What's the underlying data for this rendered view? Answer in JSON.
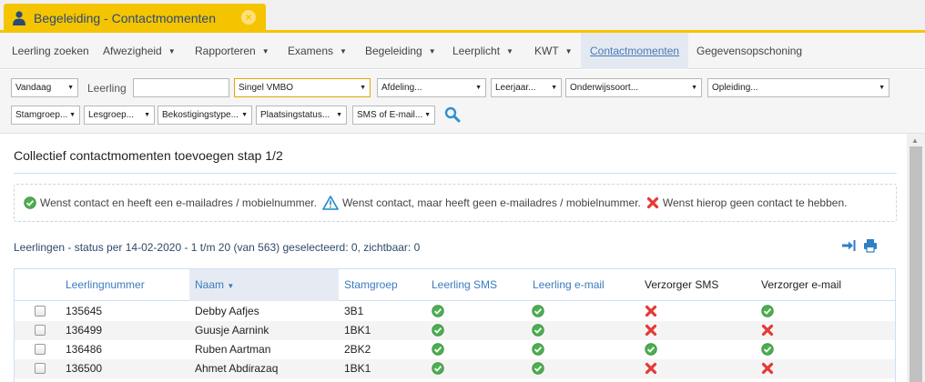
{
  "tab": {
    "title": "Begeleiding - Contactmomenten",
    "close": "×"
  },
  "menu": [
    {
      "label": "Leerling zoeken",
      "dropdown": false
    },
    {
      "label": "Afwezigheid",
      "dropdown": true
    },
    {
      "label": "Rapporteren",
      "dropdown": true
    },
    {
      "label": "Examens",
      "dropdown": true
    },
    {
      "label": "Begeleiding",
      "dropdown": true
    },
    {
      "label": "Leerplicht",
      "dropdown": true
    },
    {
      "label": "KWT",
      "dropdown": true
    },
    {
      "label": "Contactmomenten",
      "dropdown": false,
      "active": true
    },
    {
      "label": "Gegevensopschoning",
      "dropdown": false
    }
  ],
  "filters": {
    "vandaag": "Vandaag",
    "leerling_label": "Leerling",
    "leerling_value": "",
    "school": "Singel VMBO",
    "afdeling": "Afdeling...",
    "leerjaar": "Leerjaar...",
    "onderwijssoort": "Onderwijssoort...",
    "opleiding": "Opleiding...",
    "stamgroep": "Stamgroep...",
    "lesgroep": "Lesgroep...",
    "bekostigingstype": "Bekostigingstype...",
    "plaatsingstatus": "Plaatsingstatus...",
    "sms_email": "SMS of E-mail..."
  },
  "heading": "Collectief contactmomenten toevoegen stap 1/2",
  "legend": {
    "ok": "Wenst contact en heeft een e-mailadres / mobielnummer.",
    "warn": "Wenst contact, maar heeft geen e-mailadres / mobielnummer.",
    "no": "Wenst hierop geen contact te hebben."
  },
  "status_line": "Leerlingen - status per 14-02-2020 - 1 t/m 20 (van 563) geselecteerd: 0, zichtbaar: 0",
  "table": {
    "headers": {
      "nummer": "Leerlingnummer",
      "naam": "Naam",
      "stamgroep": "Stamgroep",
      "l_sms": "Leerling SMS",
      "l_email": "Leerling e-mail",
      "v_sms": "Verzorger SMS",
      "v_email": "Verzorger e-mail"
    },
    "rows": [
      {
        "nummer": "135645",
        "naam": "Debby Aafjes",
        "stamgroep": "3B1",
        "l_sms": "ok",
        "l_email": "ok",
        "v_sms": "no",
        "v_email": "ok"
      },
      {
        "nummer": "136499",
        "naam": "Guusje Aarnink",
        "stamgroep": "1BK1",
        "l_sms": "ok",
        "l_email": "ok",
        "v_sms": "no",
        "v_email": "no"
      },
      {
        "nummer": "136486",
        "naam": "Ruben Aartman",
        "stamgroep": "2BK2",
        "l_sms": "ok",
        "l_email": "ok",
        "v_sms": "ok",
        "v_email": "ok"
      },
      {
        "nummer": "136500",
        "naam": "Ahmet Abdirazaq",
        "stamgroep": "1BK1",
        "l_sms": "ok",
        "l_email": "ok",
        "v_sms": "no",
        "v_email": "no"
      }
    ]
  },
  "colors": {
    "accent": "#f5c400",
    "link": "#3a7bbf",
    "ok": "#4caf50",
    "no": "#e53935",
    "warn": "#1e88c8"
  }
}
